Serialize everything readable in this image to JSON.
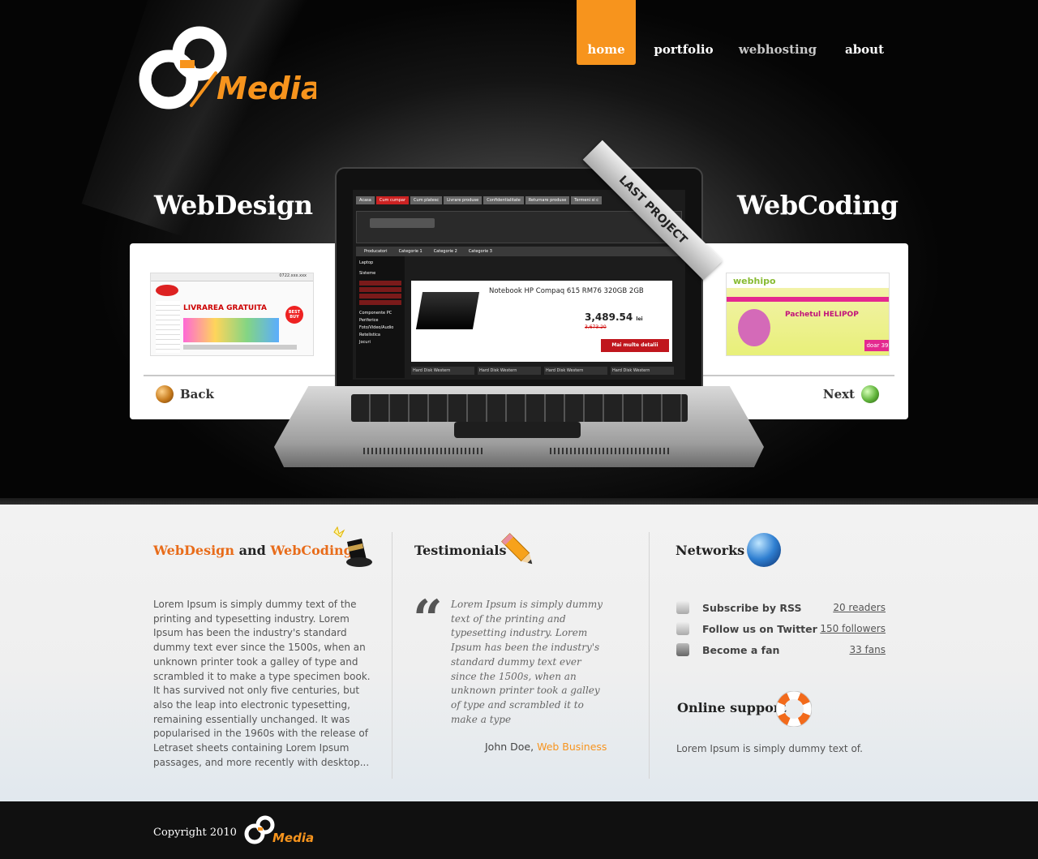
{
  "brand": {
    "logo_letters": "GO",
    "logo_word": "Media"
  },
  "nav": {
    "items": [
      {
        "label": "home",
        "active": true
      },
      {
        "label": "portfolio",
        "active": false
      },
      {
        "label": "webhosting",
        "active": false
      },
      {
        "label": "about",
        "active": false
      }
    ]
  },
  "hero": {
    "left_heading": "WebDesign",
    "right_heading": "WebCoding",
    "ribbon": "LAST PROJECT",
    "back_label": "Back",
    "next_label": "Next",
    "laptop_screen": {
      "tabs": [
        "Acasa",
        "Cum cumpar",
        "Cum platesc",
        "Livrare produse",
        "Confidentialitate",
        "Returnare produse",
        "Termeni si c"
      ],
      "product_title": "Notebook HP Compaq 615 RM76 320GB 2GB",
      "price": "3,489.54",
      "old_price": "3,673.20",
      "currency": "lei",
      "cta": "Mai multe detalii",
      "categories": [
        "Categorii",
        "Laptop",
        "Sisteme",
        "Componente PC",
        "Periferice",
        "Foto/Video/Audio",
        "Retelistica",
        "Jocuri"
      ],
      "top_menu": [
        "Producatori",
        "Categorie 1",
        "Categorie 2",
        "Categorie 3"
      ],
      "bottom_items": [
        "Hard Disk Western",
        "Hard Disk Western",
        "Hard Disk Western",
        "Hard Disk Western"
      ]
    },
    "left_thumb": {
      "phone": "0722.xxx.xxx",
      "headline": "LIVRAREA GRATUITA",
      "badge": "BEST BUY"
    },
    "right_thumb": {
      "title": "Pachetul HELIPOP",
      "brand": "webhipo",
      "tag": "doar 39"
    }
  },
  "columns": {
    "webdesign": {
      "title_part1": "WebDesign",
      "title_and": "and",
      "title_part2": "WebCoding",
      "text": "Lorem Ipsum is simply dummy text of the printing and typesetting industry. Lorem Ipsum has been the industry's standard dummy text ever since the 1500s, when an unknown printer took a galley of type and scrambled it to make a type specimen book. It has survived not only five centuries, but also the leap into electronic typesetting, remaining essentially unchanged. It was popularised in the 1960s with the release of Letraset sheets containing Lorem Ipsum passages, and more recently with desktop..."
    },
    "testimonials": {
      "title": "Testimonials",
      "quote": "Lorem Ipsum is simply dummy text of the printing and typesetting industry. Lorem Ipsum has been the industry's standard dummy text ever since the 1500s, when an unknown printer took a galley of type and scrambled it to make a type",
      "author": "John Doe,",
      "company": "Web Business"
    },
    "networks": {
      "title": "Networks",
      "items": [
        {
          "icon": "rss-icon",
          "label": "Subscribe by RSS",
          "count": "20 readers"
        },
        {
          "icon": "twitter-icon",
          "label": "Follow us on Twitter",
          "count": "150 followers"
        },
        {
          "icon": "facebook-icon",
          "label": "Become a fan",
          "count": "33 fans"
        }
      ],
      "support_title": "Online support",
      "support_text": "Lorem Ipsum is simply dummy text of."
    }
  },
  "footer": {
    "copyright": "Copyright 2010"
  },
  "colors": {
    "accent": "#f7941d",
    "orange_text": "#e86c1a",
    "hero_bg": "#111111",
    "footer_bg": "#101010"
  }
}
